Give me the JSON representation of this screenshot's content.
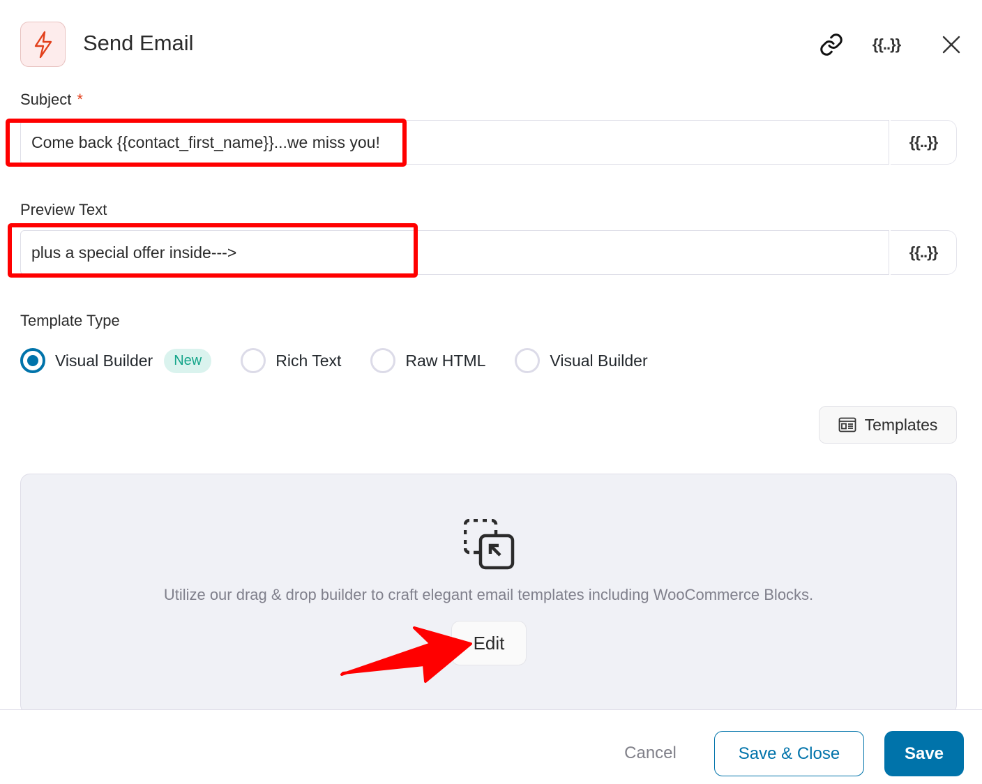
{
  "header": {
    "title": "Send Email",
    "app_icon": "lightning-bolt-icon",
    "icons": [
      "link-icon",
      "merge-tags-icon",
      "close-icon"
    ],
    "merge_tag_glyph": "{{..}}"
  },
  "subject": {
    "label": "Subject",
    "required_mark": "*",
    "value": "Come back {{contact_first_name}}...we miss you!",
    "merge_tag_glyph": "{{..}}"
  },
  "preview_text": {
    "label": "Preview Text",
    "value": "plus a special offer inside--->",
    "merge_tag_glyph": "{{..}}"
  },
  "template_type": {
    "label": "Template Type",
    "options": [
      {
        "label": "Visual Builder",
        "selected": true,
        "badge": "New"
      },
      {
        "label": "Rich Text",
        "selected": false
      },
      {
        "label": "Raw HTML",
        "selected": false
      },
      {
        "label": "Visual Builder",
        "selected": false
      }
    ]
  },
  "templates_button": {
    "label": "Templates",
    "icon": "template-layout-icon"
  },
  "builder": {
    "icon": "drag-drop-icon",
    "description": "Utilize our drag & drop builder to craft elegant email templates including WooCommerce Blocks.",
    "edit_label": "Edit"
  },
  "footer": {
    "cancel_label": "Cancel",
    "save_close_label": "Save & Close",
    "save_label": "Save"
  },
  "colors": {
    "primary": "#0073aa",
    "accent_red": "#e2401c",
    "badge_bg": "#daf3ee",
    "badge_text": "#14a58a",
    "annotation": "#ff0000"
  }
}
